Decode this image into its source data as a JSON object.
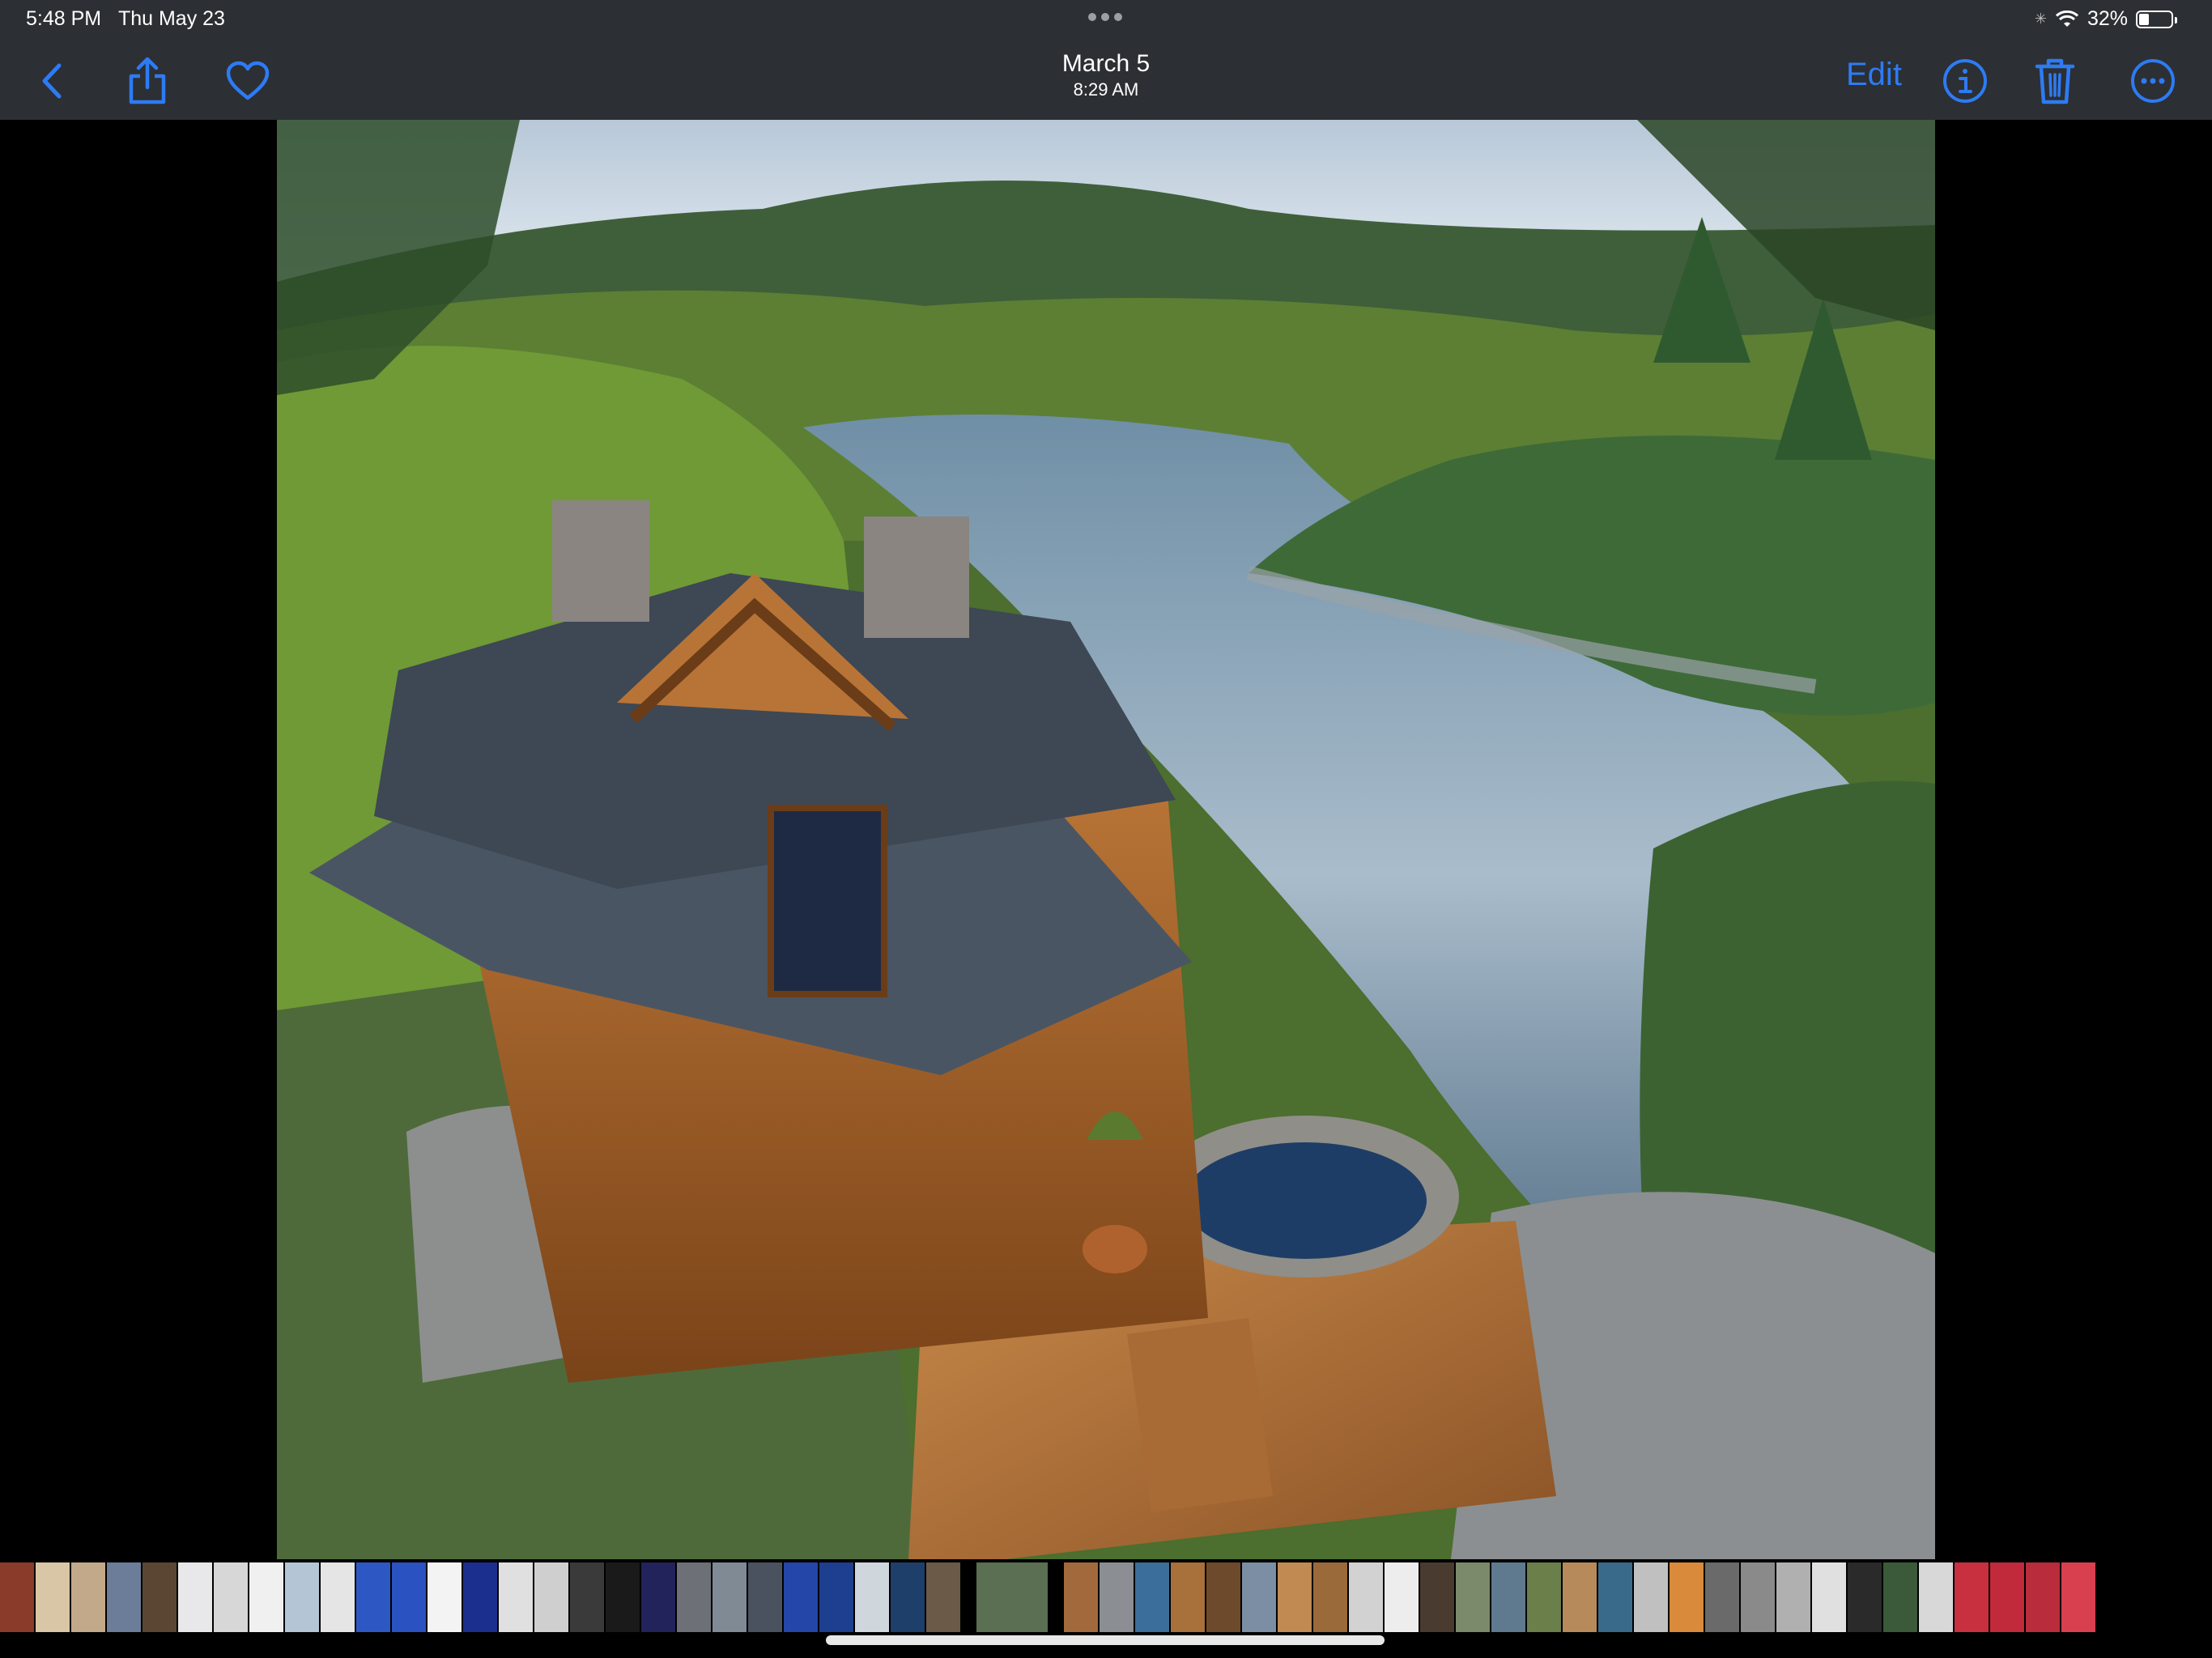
{
  "status_bar": {
    "time": "5:48 PM",
    "date": "Thu May 23",
    "battery": "32%",
    "battery_level": 0.32
  },
  "toolbar": {
    "title": "March 5",
    "subtitle": "8:29 AM",
    "edit_label": "Edit"
  },
  "icons": {
    "back": "chevron-left-icon",
    "share": "share-icon",
    "favorite": "heart-icon",
    "info": "info-icon",
    "delete": "trash-icon",
    "more": "ellipsis-circle-icon"
  },
  "colors": {
    "accent": "#2d7bf4",
    "bar_background": "#2c2f33"
  },
  "filmstrip": {
    "thumbnails": [
      "#8a3b2a",
      "#d9c6a6",
      "#c2a98a",
      "#6b7d98",
      "#5a4632",
      "#e8e8ea",
      "#d7d7d7",
      "#f0f0f0",
      "#b4c5d6",
      "#e5e5e5",
      "#2d58c4",
      "#2a52c0",
      "#f3f3f3",
      "#1b2f8f",
      "#e0e0e0",
      "#cfcfcf",
      "#3a3a3a",
      "#1a1a1a",
      "#22235a",
      "#6e7078",
      "#808a95",
      "#4a5260",
      "#2346a8",
      "#1e3e8f",
      "#cfd6dc",
      "#1f3f6b",
      "#6b5a48",
      "#5b6f52",
      "#a26a3c",
      "#8b8f93",
      "#3b6e9a",
      "#a8703a",
      "#6e4a2c",
      "#7c8ea3",
      "#c08a52",
      "#9a6a3a",
      "#d2d2d2",
      "#ededed",
      "#4a3b30",
      "#7a8a6a",
      "#5f7a8f",
      "#6a7f4a",
      "#b68a5a",
      "#3a6a8a",
      "#c0c0c0",
      "#d98a3a",
      "#6a6a6a",
      "#8a8a8a",
      "#b0b0b0",
      "#e0e0e0",
      "#2a2a2a",
      "#3a5a3a",
      "#d8d8d8",
      "#c83040",
      "#c02a3a",
      "#b82c3c",
      "#d84050"
    ],
    "current_index": 27
  }
}
